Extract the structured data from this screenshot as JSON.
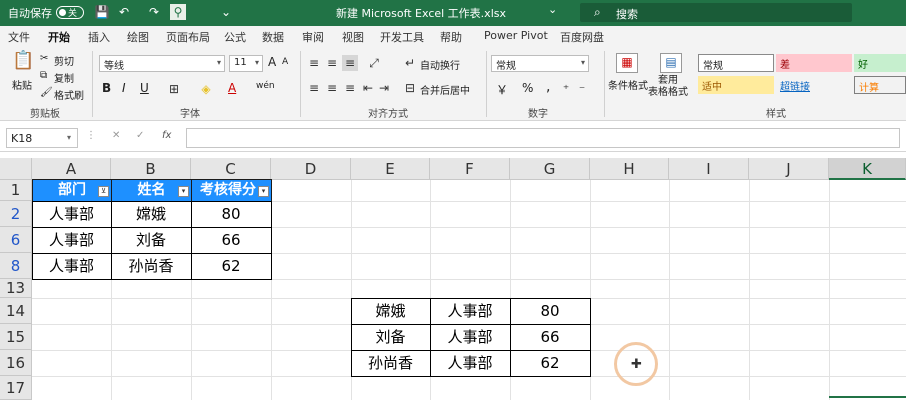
{
  "titlebar": {
    "autosave_label": "自动保存",
    "autosave_state": "关",
    "doc_title": "新建 Microsoft Excel 工作表.xlsx",
    "title_caret": "⌄",
    "search_icon": "⌕",
    "search_placeholder": "搜索",
    "icons": {
      "save": "💾",
      "undo": "↶",
      "redo": "↷",
      "filter": "⚲",
      "customize": "⌄"
    }
  },
  "menu": [
    "文件",
    "开始",
    "插入",
    "绘图",
    "页面布局",
    "公式",
    "数据",
    "审阅",
    "视图",
    "开发工具",
    "帮助",
    "Power Pivot",
    "百度网盘"
  ],
  "ribbon": {
    "clipboard": {
      "paste": "粘贴",
      "cut": "剪切",
      "copy": "复制",
      "format_painter": "格式刷",
      "group": "剪贴板"
    },
    "font": {
      "name": "等线",
      "size": "11",
      "bold": "B",
      "italic": "I",
      "underline": "U",
      "grow": "A",
      "shrink": "A",
      "phonetic": "wén",
      "group": "字体"
    },
    "alignment": {
      "wrap": "自动换行",
      "merge": "合并后居中",
      "group": "对齐方式"
    },
    "number": {
      "format": "常规",
      "currency": "￥",
      "percent": "%",
      "comma": ",",
      "group": "数字"
    },
    "styles": {
      "conditional": "条件格式",
      "table": "套用\n表格格式",
      "normal": "常规",
      "bad": "差",
      "good": "好",
      "neutral": "适中",
      "hyperlink": "超链接",
      "calc": "计算",
      "group": "样式"
    }
  },
  "formula_bar": {
    "name_box": "K18",
    "cancel": "✕",
    "enter": "✓",
    "fx": "fx",
    "value": ""
  },
  "columns": [
    "A",
    "B",
    "C",
    "D",
    "E",
    "F",
    "G",
    "H",
    "I",
    "J",
    "K"
  ],
  "rows": [
    "1",
    "2",
    "6",
    "8",
    "13",
    "14",
    "15",
    "16",
    "17"
  ],
  "table1": {
    "headers": [
      "部门",
      "姓名",
      "考核得分"
    ],
    "rows": [
      [
        "人事部",
        "嫦娥",
        "80"
      ],
      [
        "人事部",
        "刘备",
        "66"
      ],
      [
        "人事部",
        "孙尚香",
        "62"
      ]
    ],
    "header_color": "#1e90ff"
  },
  "table2": {
    "rows": [
      [
        "嫦娥",
        "人事部",
        "80"
      ],
      [
        "刘备",
        "人事部",
        "66"
      ],
      [
        "孙尚香",
        "人事部",
        "62"
      ]
    ]
  },
  "colors": {
    "accent": "#217346"
  }
}
